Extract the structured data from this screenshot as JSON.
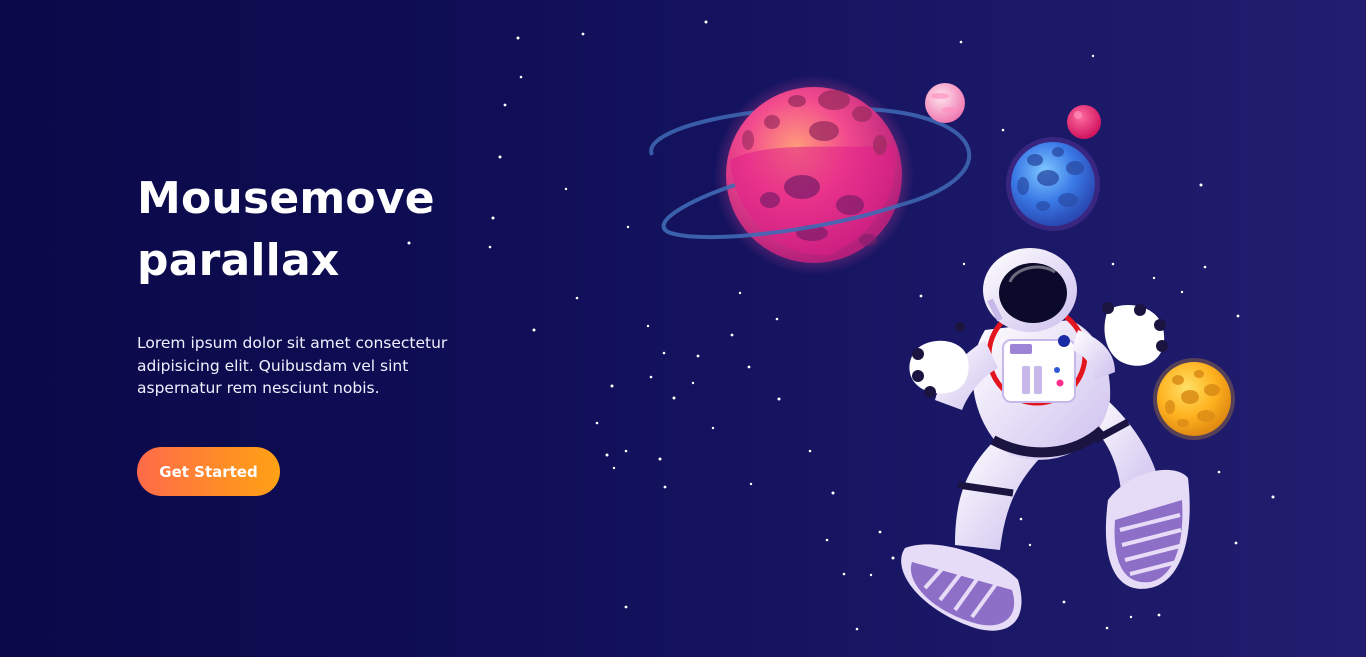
{
  "hero": {
    "title": "Mousemove\nparallax",
    "description": "Lorem ipsum dolor sit amet consectetur adipisicing elit. Quibusdam vel sint aspernatur rem nesciunt nobis.",
    "cta_label": "Get Started"
  },
  "colors": {
    "background": "#0f0e56",
    "cta_gradient_start": "#ff6a4a",
    "cta_gradient_end": "#ffa114",
    "text": "#ffffff"
  },
  "illustration": {
    "elements": [
      "ringed-planet-icon",
      "small-pink-planet-icon",
      "small-magenta-planet-icon",
      "blue-planet-icon",
      "orange-planet-icon",
      "astronaut-icon",
      "star-field"
    ]
  }
}
